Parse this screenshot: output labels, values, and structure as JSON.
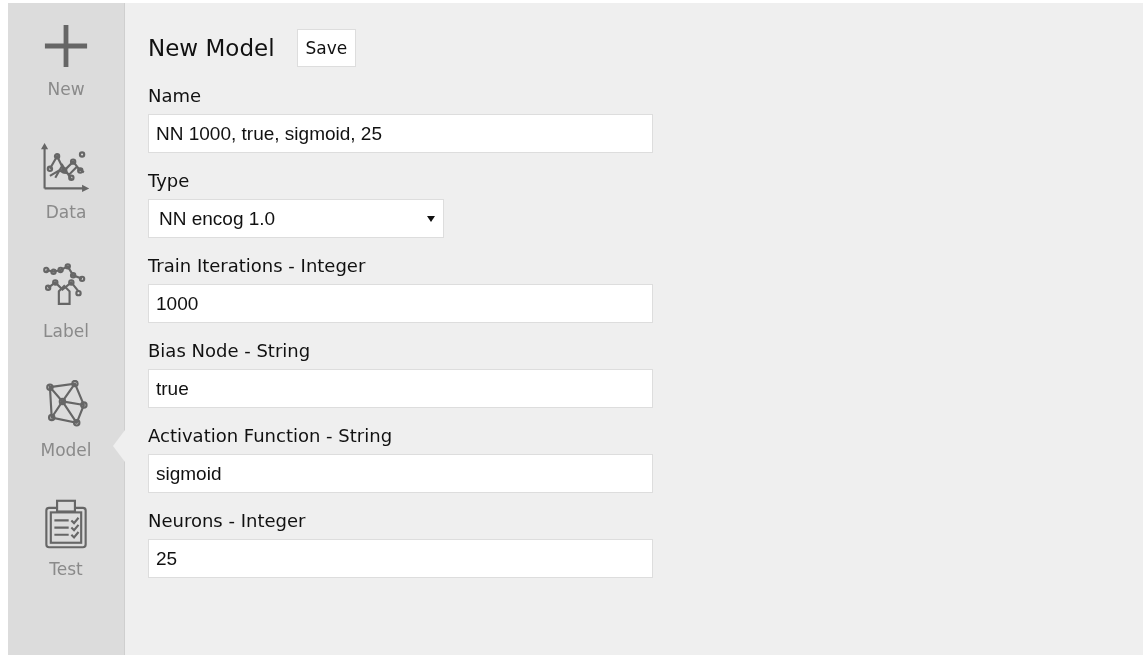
{
  "sidebar": {
    "items": [
      {
        "kind": "plus",
        "label": "New",
        "selected": false
      },
      {
        "kind": "data",
        "label": "Data",
        "selected": false
      },
      {
        "kind": "label",
        "label": "Label",
        "selected": false
      },
      {
        "kind": "model",
        "label": "Model",
        "selected": true
      },
      {
        "kind": "test",
        "label": "Test",
        "selected": false
      }
    ]
  },
  "header": {
    "title": "New Model",
    "save_button": "Save"
  },
  "fields": [
    {
      "kind": "text",
      "label": "Name",
      "value": "NN 1000, true, sigmoid, 25"
    },
    {
      "kind": "select",
      "label": "Type",
      "value": "NN encog 1.0"
    },
    {
      "kind": "text",
      "label": "Train Iterations - Integer",
      "value": "1000"
    },
    {
      "kind": "text",
      "label": "Bias Node - String",
      "value": "true"
    },
    {
      "kind": "text",
      "label": "Activation Function - String",
      "value": "sigmoid"
    },
    {
      "kind": "text",
      "label": "Neurons - Integer",
      "value": "25"
    }
  ]
}
